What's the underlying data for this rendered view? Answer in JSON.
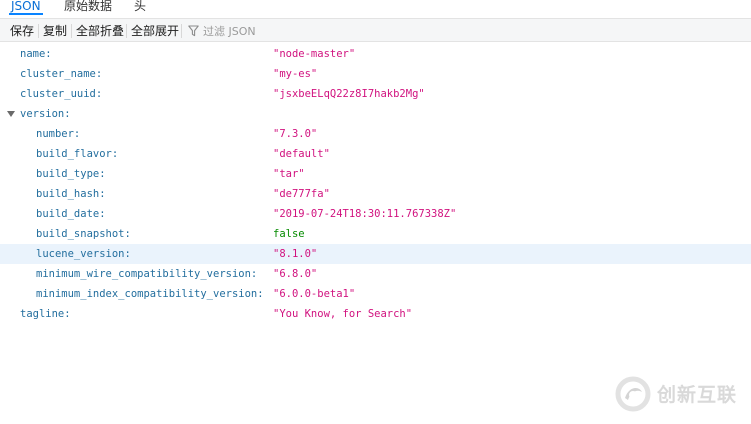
{
  "tabs": [
    {
      "label": "JSON",
      "active": true
    },
    {
      "label": "原始数据",
      "active": false
    },
    {
      "label": "头",
      "active": false
    }
  ],
  "toolbar": {
    "save": "保存",
    "copy": "复制",
    "collapse_all": "全部折叠",
    "expand_all": "全部展开",
    "filter_placeholder": "过滤 JSON",
    "filter_icon": "funnel-icon"
  },
  "colors": {
    "key": "#236e9e",
    "string": "#d1127f",
    "boolean": "#058b00",
    "highlight_row": "#eaf3fc",
    "active_tab": "#0a84ff"
  },
  "json": {
    "name": {
      "key": "name:",
      "value": "\"node-master\""
    },
    "cluster_name": {
      "key": "cluster_name:",
      "value": "\"my-es\""
    },
    "cluster_uuid": {
      "key": "cluster_uuid:",
      "value": "\"jsxbeELqQ22z8I7hakb2Mg\""
    },
    "version": {
      "key": "version:",
      "expanded": true,
      "number": {
        "key": "number:",
        "value": "\"7.3.0\""
      },
      "build_flavor": {
        "key": "build_flavor:",
        "value": "\"default\""
      },
      "build_type": {
        "key": "build_type:",
        "value": "\"tar\""
      },
      "build_hash": {
        "key": "build_hash:",
        "value": "\"de777fa\""
      },
      "build_date": {
        "key": "build_date:",
        "value": "\"2019-07-24T18:30:11.767338Z\""
      },
      "build_snapshot": {
        "key": "build_snapshot:",
        "value": "false"
      },
      "lucene_version": {
        "key": "lucene_version:",
        "value": "\"8.1.0\""
      },
      "minimum_wire_compatibility_version": {
        "key": "minimum_wire_compatibility_version:",
        "value": "\"6.8.0\""
      },
      "minimum_index_compatibility_version": {
        "key": "minimum_index_compatibility_version:",
        "value": "\"6.0.0-beta1\""
      }
    },
    "tagline": {
      "key": "tagline:",
      "value": "\"You Know, for Search\""
    }
  },
  "watermark": {
    "text": "创新互联",
    "icon": "brand-logo-icon"
  }
}
